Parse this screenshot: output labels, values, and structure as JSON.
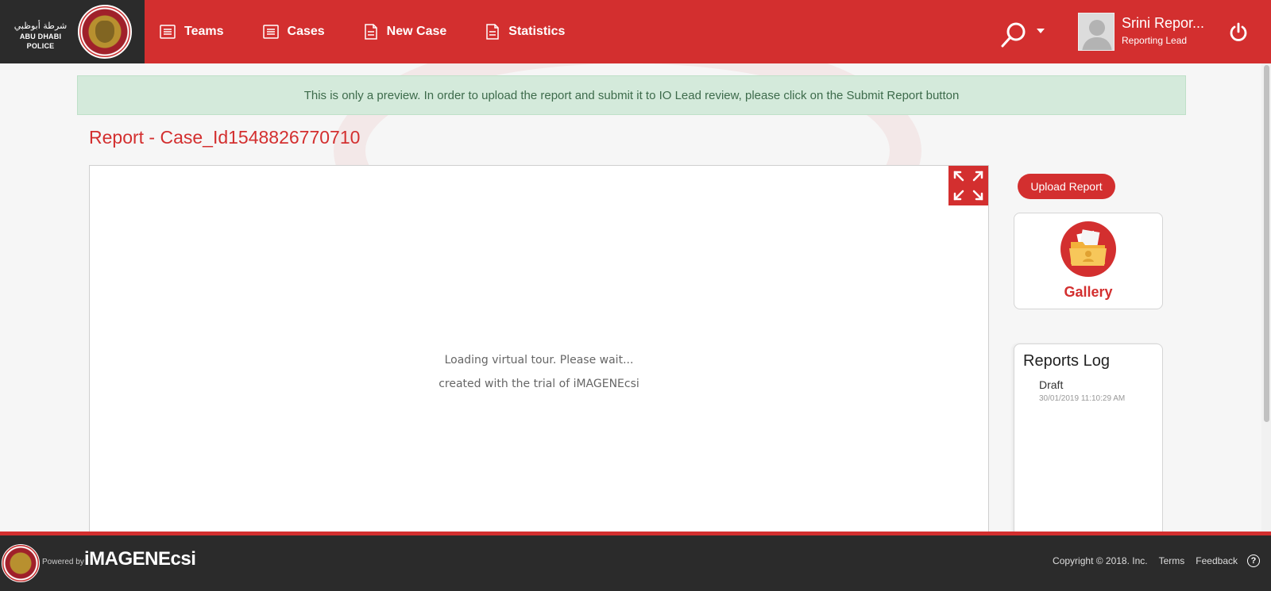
{
  "brand": {
    "arabic": "شرطة أبوظبي",
    "english": "ABU DHABI POLICE"
  },
  "nav": {
    "items": [
      {
        "label": "Teams",
        "icon": "list-icon"
      },
      {
        "label": "Cases",
        "icon": "list-icon"
      },
      {
        "label": "New Case",
        "icon": "document-icon"
      },
      {
        "label": "Statistics",
        "icon": "document-icon"
      }
    ]
  },
  "user": {
    "name": "Srini Repor...",
    "role": "Reporting Lead"
  },
  "alert": "This is only a preview. In order to upload the report and submit it to IO Lead review, please click on the Submit Report button",
  "report": {
    "title": "Report - Case_Id1548826770710",
    "loading_line1": "Loading virtual tour. Please wait...",
    "loading_line2": "created with the trial of iMAGENEcsi"
  },
  "sidebar": {
    "upload_label": "Upload Report",
    "gallery_label": "Gallery",
    "log": {
      "title": "Reports Log",
      "entries": [
        {
          "status": "Draft",
          "date": "30/01/2019 11:10:29 AM"
        }
      ]
    }
  },
  "footer": {
    "powered_by": "Powered by",
    "product": "iMAGENEcsi",
    "copyright": "Copyright © 2018. Inc.",
    "terms": "Terms",
    "feedback": "Feedback",
    "help": "?"
  },
  "colors": {
    "accent": "#d32f2f",
    "dark": "#2b2b2b",
    "alert_bg": "#d4eadb"
  }
}
